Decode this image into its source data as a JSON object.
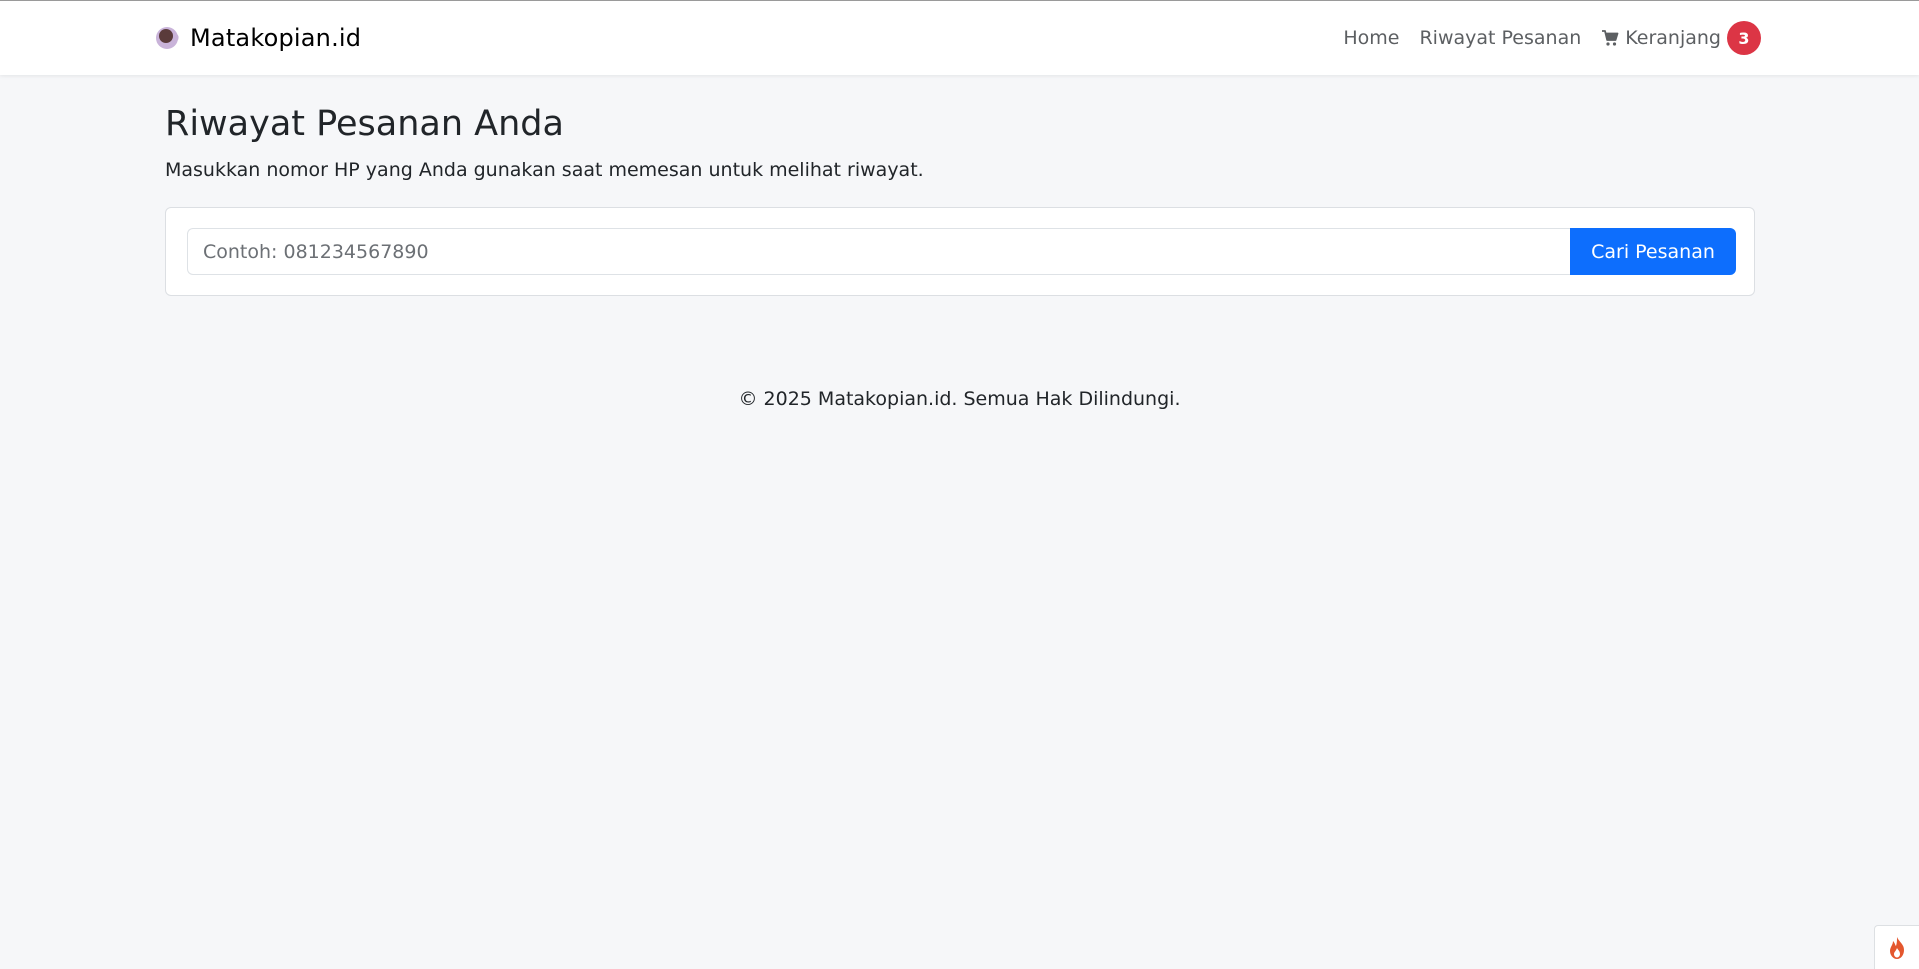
{
  "navbar": {
    "brand": "Matakopian.id",
    "brand_icon": "coffee-cup-icon",
    "links": [
      {
        "label": "Home"
      },
      {
        "label": "Riwayat Pesanan"
      },
      {
        "label": "Keranjang",
        "icon": "cart-icon",
        "badge": "3"
      }
    ]
  },
  "main": {
    "title": "Riwayat Pesanan Anda",
    "subtitle": "Masukkan nomor HP yang Anda gunakan saat memesan untuk melihat riwayat.",
    "search": {
      "placeholder": "Contoh: 081234567890",
      "value": "",
      "button_label": "Cari Pesanan"
    }
  },
  "footer": {
    "text": "© 2025 Matakopian.id. Semua Hak Dilindungi."
  },
  "debug_toolbar": {
    "icon": "flame-icon"
  },
  "colors": {
    "primary": "#0d6efd",
    "badge": "#dc3545",
    "background": "#f6f7f9",
    "flame": "#e4572e"
  }
}
